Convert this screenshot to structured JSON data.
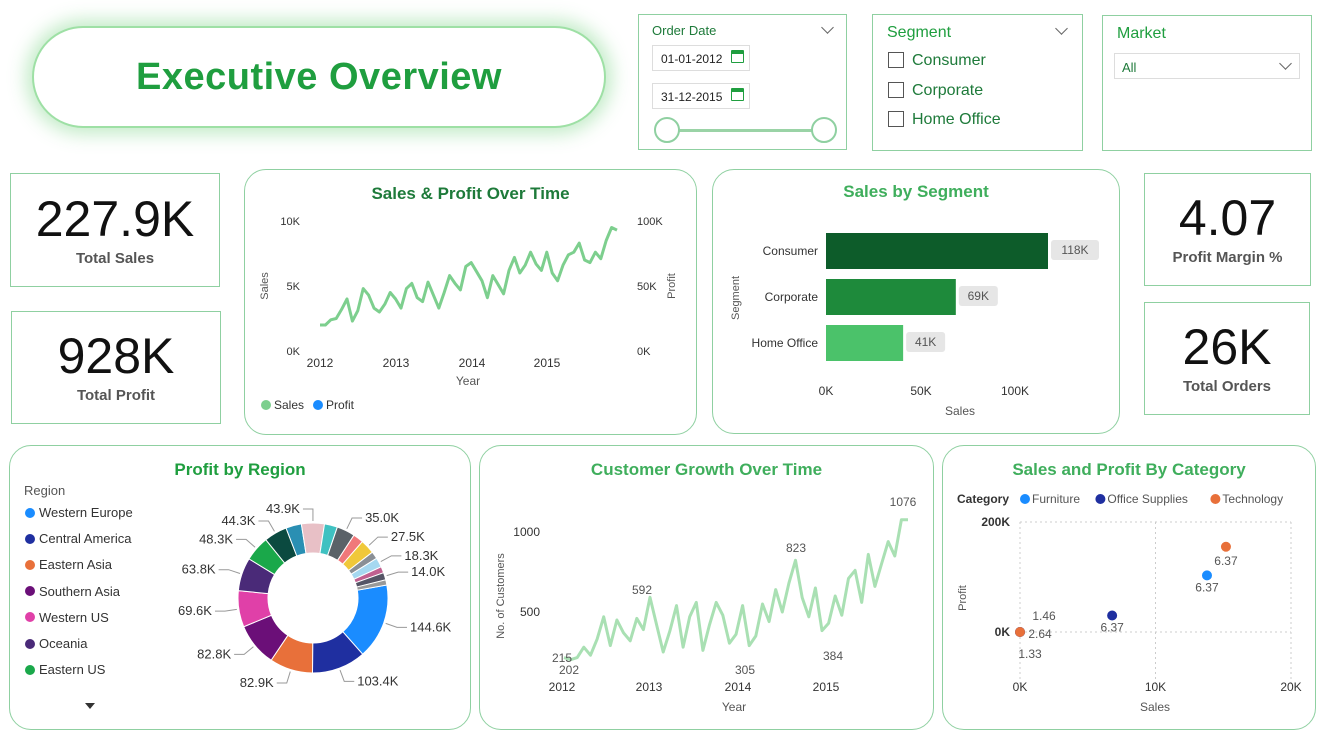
{
  "header": {
    "title": "Executive Overview"
  },
  "filters": {
    "order_date": {
      "label": "Order Date",
      "start": "01-01-2012",
      "end": "31-12-2015"
    },
    "segment": {
      "label": "Segment",
      "options": [
        "Consumer",
        "Corporate",
        "Home Office"
      ]
    },
    "market": {
      "label": "Market",
      "selected": "All"
    }
  },
  "kpis": {
    "total_sales": {
      "value": "227.9K",
      "label": "Total Sales"
    },
    "total_profit": {
      "value": "928K",
      "label": "Total Profit"
    },
    "profit_margin": {
      "value": "4.07",
      "label": "Profit Margin %"
    },
    "total_orders": {
      "value": "26K",
      "label": "Total Orders"
    }
  },
  "colors": {
    "accent": "#1f9e3f",
    "border": "#8fd0a1",
    "sales_line": "#7dcf8e",
    "profit_line": "#1a8cff"
  },
  "chart_data": [
    {
      "type": "line",
      "title": "Sales & Profit Over Time",
      "xlabel": "Year",
      "ylabel": "Sales",
      "y2label": "Profit",
      "x_ticks": [
        "2012",
        "2013",
        "2014",
        "2015"
      ],
      "y_ticks": [
        "0K",
        "5K",
        "10K"
      ],
      "y2_ticks": [
        "0K",
        "50K",
        "100K"
      ],
      "ylim": [
        0,
        10000
      ],
      "y2lim": [
        0,
        100000
      ],
      "series": [
        {
          "name": "Sales",
          "axis": "left",
          "values": [
            2000,
            2000,
            2400,
            2500,
            3200,
            4000,
            2300,
            3100,
            4800,
            4300,
            3300,
            3000,
            3600,
            4500,
            4000,
            3300,
            4800,
            5200,
            4100,
            3800,
            5300,
            4300,
            3300,
            4500,
            5800,
            5200,
            4700,
            6500,
            6800,
            6100,
            5400,
            4100,
            5800,
            5100,
            4400,
            6200,
            7200,
            6000,
            6600,
            7600,
            6700,
            6200,
            7600,
            6000,
            5400,
            6600,
            7400,
            7600,
            8300,
            7000,
            6800,
            7600,
            7100,
            8500,
            9500,
            9300
          ]
        },
        {
          "name": "Profit",
          "axis": "right",
          "values": [
            2000,
            2000,
            2100,
            2000,
            2300,
            2800,
            1800,
            2200,
            2600,
            2500,
            2200,
            2000,
            2300,
            2900,
            2600,
            2000,
            2700,
            2900,
            2500,
            2200,
            3000,
            2600,
            2200,
            2700,
            3000,
            2800,
            2600,
            3100,
            2500,
            2500,
            2700,
            3300,
            3200,
            2800,
            3100,
            3400,
            2600,
            2800,
            2400,
            2700,
            3300,
            3500,
            3700,
            3100,
            3000,
            3700,
            3100,
            3300,
            3800,
            4000,
            3600,
            3200,
            4000,
            4100,
            3400,
            3700
          ]
        }
      ],
      "legend": "bottom-left"
    },
    {
      "type": "bar",
      "orientation": "horizontal",
      "title": "Sales by Segment",
      "xlabel": "Sales",
      "ylabel": "Segment",
      "categories": [
        "Consumer",
        "Corporate",
        "Home Office"
      ],
      "values": [
        118000,
        69000,
        41000
      ],
      "data_labels": [
        "118K",
        "69K",
        "41K"
      ],
      "x_ticks": [
        "0K",
        "50K",
        "100K"
      ],
      "xlim": [
        0,
        118000
      ],
      "colors": [
        "#0d5c2a",
        "#1e8a3b",
        "#4bc26a"
      ]
    },
    {
      "type": "pie",
      "variant": "donut",
      "title": "Profit by Region",
      "legend_title": "Region",
      "legend": [
        "Western Europe",
        "Central America",
        "Eastern Asia",
        "Southern Asia",
        "Western US",
        "Oceania",
        "Eastern US"
      ],
      "slices": [
        {
          "label": "144.6K",
          "value": 144.6,
          "color": "#1a8cff"
        },
        {
          "label": "103.4K",
          "value": 103.4,
          "color": "#1f2fa0"
        },
        {
          "label": "82.9K",
          "value": 82.9,
          "color": "#e8703a"
        },
        {
          "label": "82.8K",
          "value": 82.8,
          "color": "#6b0f78"
        },
        {
          "label": "69.6K",
          "value": 69.6,
          "color": "#e040a8"
        },
        {
          "label": "63.8K",
          "value": 63.8,
          "color": "#4a2a78"
        },
        {
          "label": "48.3K",
          "value": 48.3,
          "color": "#1aa84a"
        },
        {
          "label": "44.3K",
          "value": 44.3,
          "color": "#0b4a40"
        },
        {
          "label": "",
          "value": 30,
          "color": "#2a8fb3"
        },
        {
          "label": "43.9K",
          "value": 43.9,
          "color": "#e8c0c6"
        },
        {
          "label": "",
          "value": 25,
          "color": "#3fc1c1"
        },
        {
          "label": "35.0K",
          "value": 35.0,
          "color": "#5a6268"
        },
        {
          "label": "",
          "value": 20,
          "color": "#f0787a"
        },
        {
          "label": "27.5K",
          "value": 27.5,
          "color": "#f0c83a"
        },
        {
          "label": "",
          "value": 14,
          "color": "#8a8f95"
        },
        {
          "label": "18.3K",
          "value": 18.3,
          "color": "#a5d8f0"
        },
        {
          "label": "",
          "value": 12,
          "color": "#c06090"
        },
        {
          "label": "14.0K",
          "value": 14.0,
          "color": "#556"
        },
        {
          "label": "",
          "value": 10,
          "color": "#999"
        }
      ]
    },
    {
      "type": "line",
      "title": "Customer Growth Over Time",
      "xlabel": "Year",
      "ylabel": "No. of Customers",
      "x_ticks": [
        "2012",
        "2013",
        "2014",
        "2015"
      ],
      "y_ticks": [
        "500",
        "1000"
      ],
      "ylim": [
        150,
        1150
      ],
      "values": [
        215,
        202,
        215,
        280,
        230,
        330,
        470,
        290,
        450,
        370,
        320,
        460,
        390,
        592,
        420,
        250,
        380,
        540,
        280,
        470,
        560,
        260,
        420,
        560,
        480,
        305,
        360,
        540,
        290,
        350,
        550,
        440,
        640,
        500,
        680,
        823,
        590,
        470,
        650,
        384,
        430,
        600,
        480,
        710,
        760,
        560,
        860,
        660,
        800,
        940,
        850,
        1076,
        1076
      ],
      "annotations": [
        "215",
        "202",
        "592",
        "305",
        "823",
        "384",
        "1076"
      ],
      "color": "#a9e0b3"
    },
    {
      "type": "scatter",
      "title": "Sales and Profit By Category",
      "xlabel": "Sales",
      "ylabel": "Profit",
      "legend_title": "Category",
      "x_ticks": [
        "0K",
        "10K",
        "20K"
      ],
      "y_ticks": [
        "0K",
        "200K"
      ],
      "xlim": [
        0,
        20000
      ],
      "ylim": [
        -100000,
        200000
      ],
      "series": [
        {
          "name": "Furniture",
          "color": "#1a8cff",
          "points": [
            {
              "x": 13800,
              "y": 103000,
              "label": "6.37"
            },
            {
              "x": 0,
              "y": 0,
              "label": "1.46"
            }
          ]
        },
        {
          "name": "Office Supplies",
          "color": "#1f2fa0",
          "points": [
            {
              "x": 6800,
              "y": 30000,
              "label": "6.37"
            },
            {
              "x": 0,
              "y": 0,
              "label": "2.64"
            }
          ]
        },
        {
          "name": "Technology",
          "color": "#e8703a",
          "points": [
            {
              "x": 15200,
              "y": 155000,
              "label": "6.37"
            },
            {
              "x": 0,
              "y": 0,
              "label": "1.33"
            }
          ]
        }
      ]
    }
  ]
}
